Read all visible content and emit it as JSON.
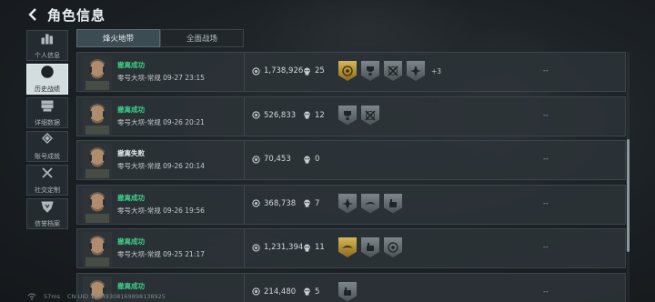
{
  "header": {
    "title": "角色信息"
  },
  "sidebar": {
    "items": [
      {
        "label": "个人信息",
        "icon": "bar-chart-icon",
        "active": false
      },
      {
        "label": "历史战绩",
        "icon": "history-icon",
        "active": true
      },
      {
        "label": "详细数据",
        "icon": "stack-icon",
        "active": false
      },
      {
        "label": "账号成就",
        "icon": "medal-icon",
        "active": false
      },
      {
        "label": "社交定制",
        "icon": "tools-icon",
        "active": false
      },
      {
        "label": "信誉档案",
        "icon": "shield-heart-icon",
        "active": false
      }
    ]
  },
  "tabs": [
    {
      "label": "烽火地带",
      "active": true
    },
    {
      "label": "全面战场",
      "active": false
    }
  ],
  "records": [
    {
      "result": "撤离成功",
      "status": "success",
      "map": "零号大坝-常规",
      "time": "09-27 23:15",
      "value": "1,738,926",
      "kills": "25",
      "badges": [
        "gold",
        "silver",
        "silver",
        "silver"
      ],
      "more": "+3",
      "extra": "--"
    },
    {
      "result": "撤离成功",
      "status": "success",
      "map": "零号大坝-常规",
      "time": "09-26 20:21",
      "value": "526,833",
      "kills": "12",
      "badges": [
        "silver",
        "silver"
      ],
      "more": "",
      "extra": "--"
    },
    {
      "result": "撤离失败",
      "status": "fail",
      "map": "零号大坝-常规",
      "time": "09-26 20:14",
      "value": "70,453",
      "kills": "0",
      "badges": [],
      "more": "",
      "extra": "--"
    },
    {
      "result": "撤离成功",
      "status": "success",
      "map": "零号大坝-常规",
      "time": "09-26 19:56",
      "value": "368,738",
      "kills": "7",
      "badges": [
        "silver",
        "silver",
        "silver"
      ],
      "more": "",
      "extra": "--"
    },
    {
      "result": "撤离成功",
      "status": "success",
      "map": "零号大坝-常规",
      "time": "09-25 21:17",
      "value": "1,231,394",
      "kills": "11",
      "badges": [
        "gold",
        "silver",
        "silver"
      ],
      "more": "",
      "extra": "--"
    },
    {
      "result": "撤离成功",
      "status": "success",
      "map": "",
      "time": "",
      "value": "214,480",
      "kills": "5",
      "badges": [
        "silver"
      ],
      "more": "",
      "extra": "--"
    }
  ],
  "scroll": {
    "thumb_start": 0.35,
    "thumb_fraction": 0.45
  },
  "footer": {
    "ping": "57ms",
    "uid": "CN UID 18449308169898138925"
  },
  "colors": {
    "success": "#3fd18a",
    "accent": "#d7b65a",
    "active_tab": "#3b4c52"
  }
}
